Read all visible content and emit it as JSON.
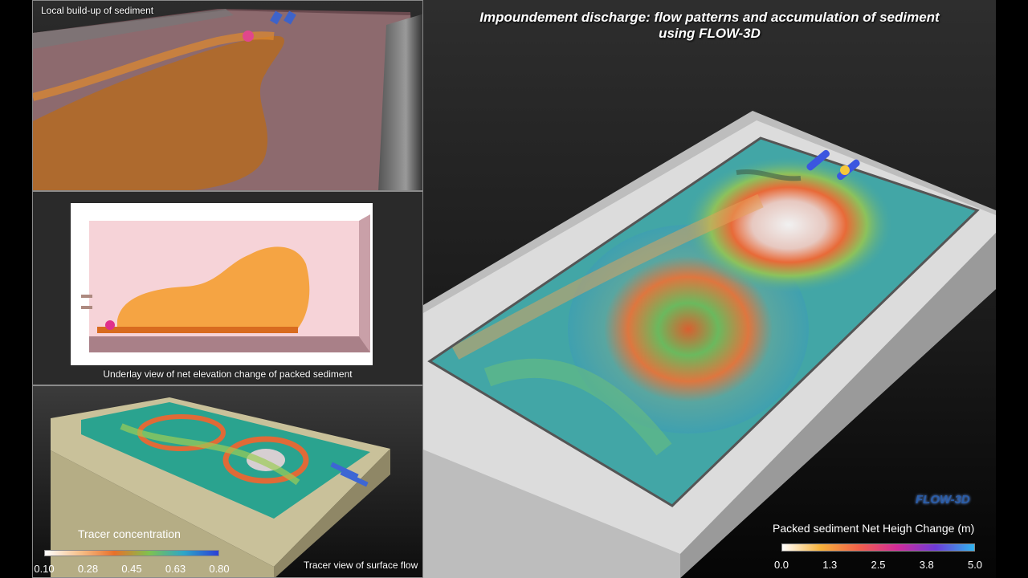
{
  "video": {
    "title_line1": "Impoundement discharge: flow patterns and accumulation of sediment",
    "title_line2": "using FLOW-3D",
    "logo": "FLOW-3D"
  },
  "panels": {
    "top_left_label": "Local build-up of sediment",
    "middle_left_label": "Underlay view of net elevation change of packed sediment",
    "bottom_left_label": "Tracer view of surface flow"
  },
  "tracer_colorbar": {
    "title": "Tracer concentration",
    "ticks": [
      "0.10",
      "0.28",
      "0.45",
      "0.63",
      "0.80"
    ]
  },
  "sediment_colorbar": {
    "title": "Packed sediment Net Heigh Change (m)",
    "ticks": [
      "0.0",
      "1.3",
      "2.5",
      "3.8",
      "5.0"
    ]
  },
  "colors": {
    "tracer_gradient": [
      "#ffffff",
      "#f6c18b",
      "#e8702a",
      "#7fc24f",
      "#2da6c8",
      "#2b3fd6"
    ],
    "sediment_gradient": [
      "#ffffff",
      "#f7b23b",
      "#f2604a",
      "#d22b9a",
      "#6d3bd8",
      "#2fb5f0"
    ],
    "logo": "#2a5da8"
  }
}
